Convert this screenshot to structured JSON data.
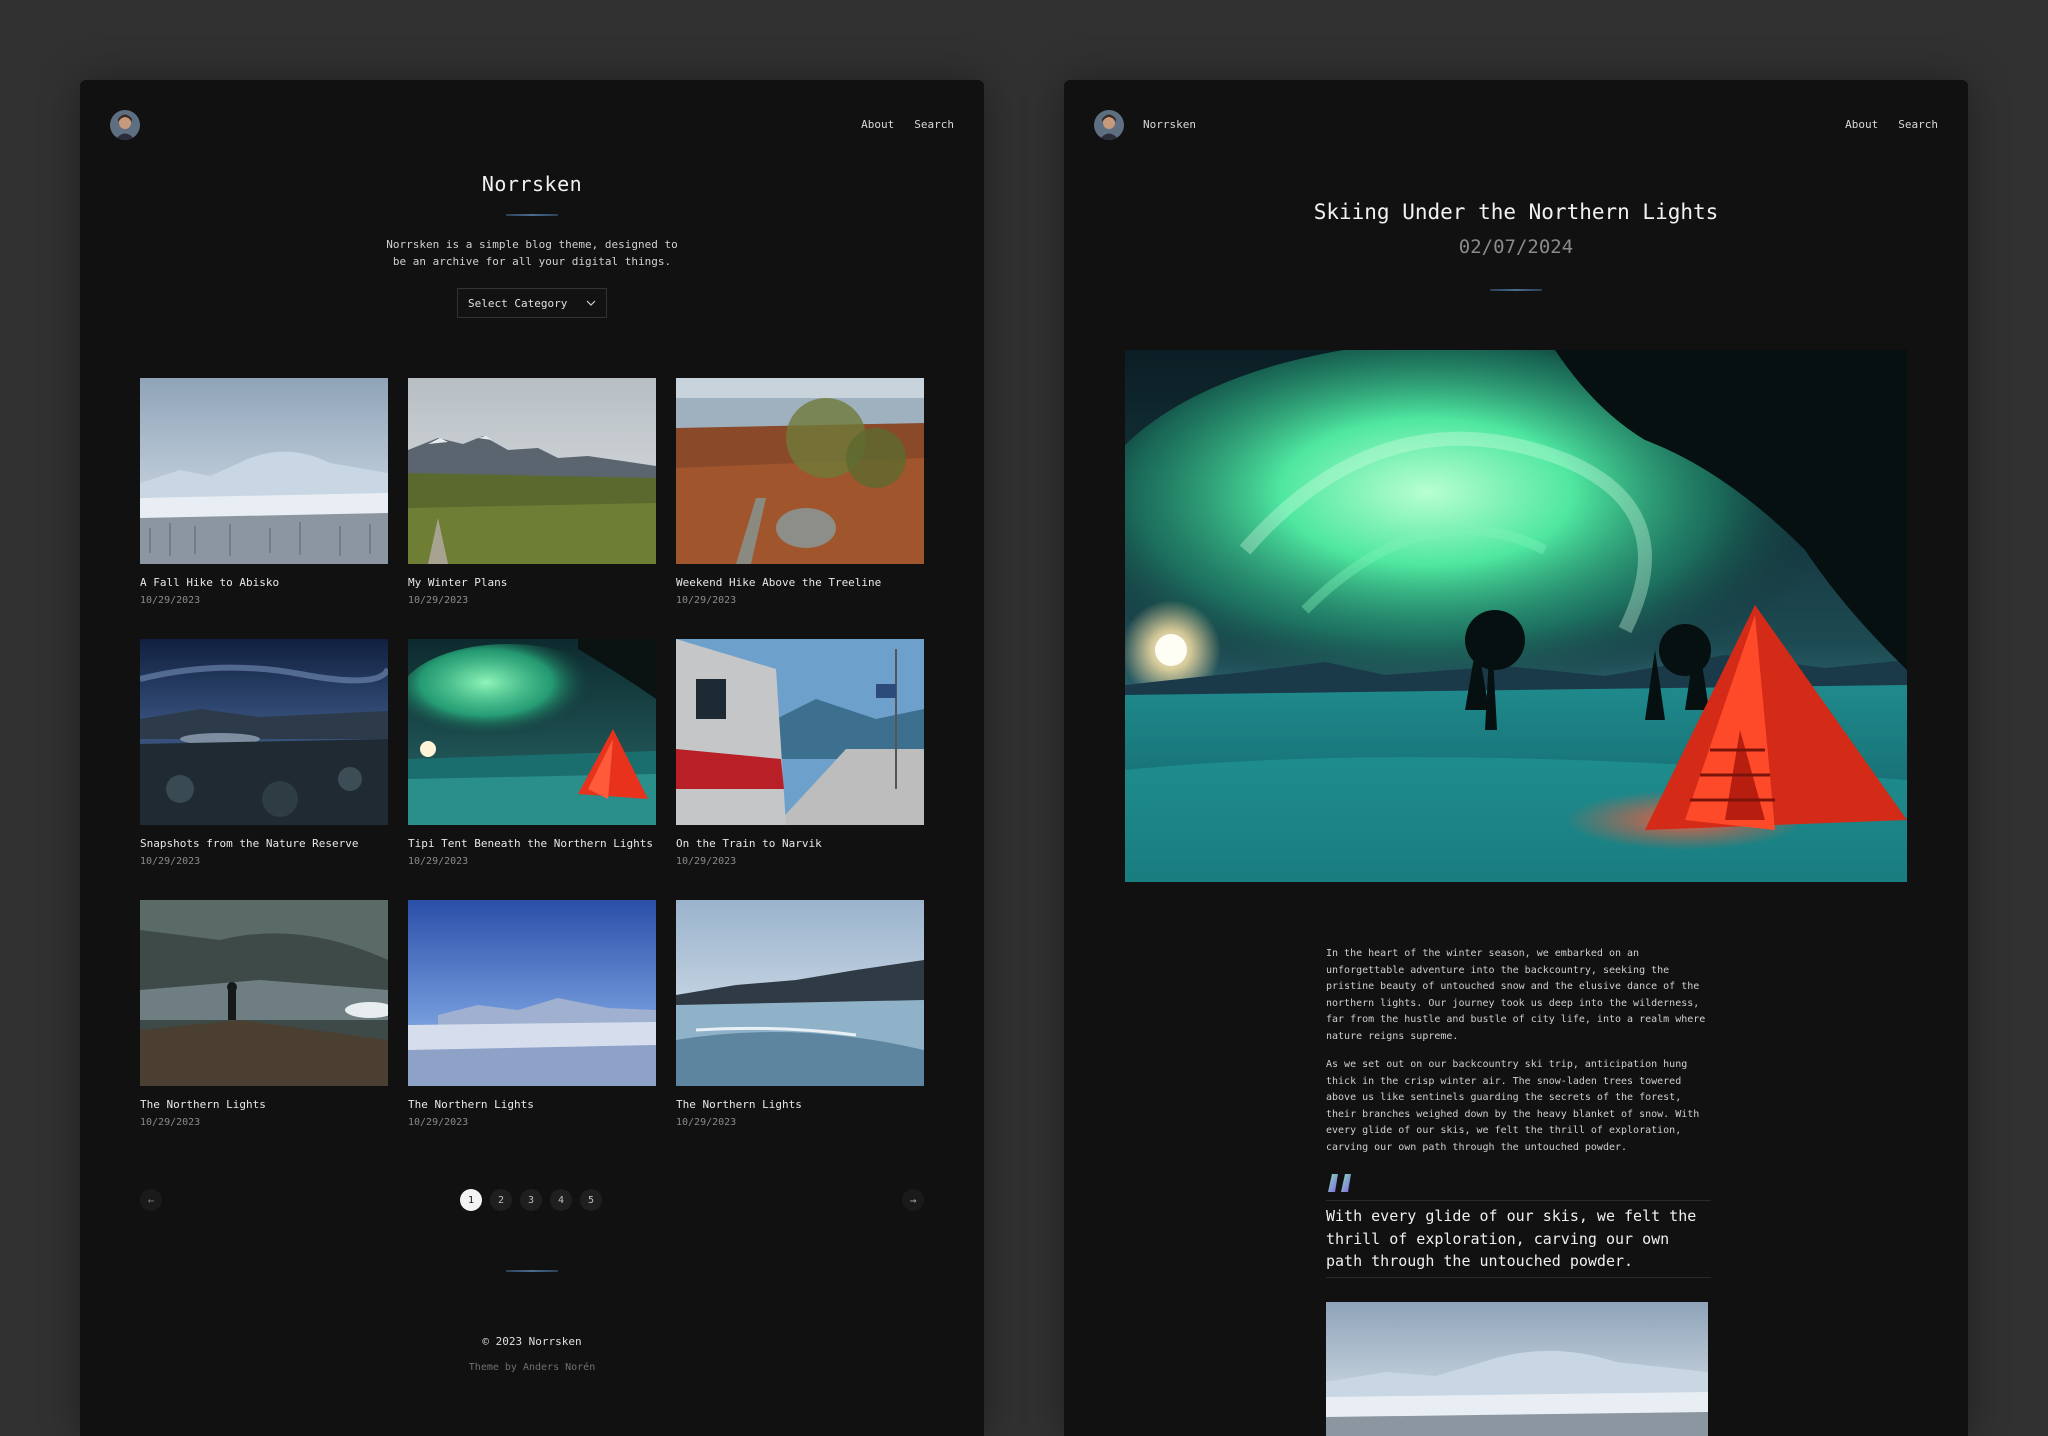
{
  "left": {
    "nav": {
      "about": "About",
      "search": "Search"
    },
    "blog_title": "Norrsken",
    "tagline_line1": "Norrsken is a simple blog theme, designed to",
    "tagline_line2": "be an archive for all your digital things.",
    "category_select": {
      "selected": "Select Category",
      "icon": "chevron-down-icon"
    },
    "posts": [
      {
        "title": "A Fall Hike to Abisko",
        "date": "10/29/2023"
      },
      {
        "title": "My Winter Plans",
        "date": "10/29/2023"
      },
      {
        "title": "Weekend Hike Above the Treeline",
        "date": "10/29/2023"
      },
      {
        "title": "Snapshots from the Nature Reserve",
        "date": "10/29/2023"
      },
      {
        "title": "Tipi Tent Beneath the Northern Lights",
        "date": "10/29/2023"
      },
      {
        "title": "On the Train to Narvik",
        "date": "10/29/2023"
      },
      {
        "title": "The Northern Lights",
        "date": "10/29/2023"
      },
      {
        "title": "The Northern Lights",
        "date": "10/29/2023"
      },
      {
        "title": "The Northern Lights",
        "date": "10/29/2023"
      }
    ],
    "pagination": {
      "pages": [
        "1",
        "2",
        "3",
        "4",
        "5"
      ],
      "current": "1",
      "prev": "←",
      "next": "→"
    },
    "footer": {
      "copyright": "© 2023 Norrsken",
      "credit": "Theme by Anders Norén"
    }
  },
  "right": {
    "site_name": "Norrsken",
    "nav": {
      "about": "About",
      "search": "Search"
    },
    "post": {
      "title": "Skiing Under the Northern Lights",
      "date": "02/07/2024",
      "paragraph1": "In the heart of the winter season, we embarked on an unforgettable adventure into the backcountry, seeking the pristine beauty of untouched snow and the elusive dance of the northern lights. Our journey took us deep into the wilderness, far from the hustle and bustle of city life, into a realm where nature reigns supreme.",
      "paragraph2": "As we set out on our backcountry ski trip, anticipation hung thick in the crisp winter air. The snow-laden trees towered above us like sentinels guarding the secrets of the forest, their branches weighed down by the heavy blanket of snow. With every glide of our skis, we felt the thrill of exploration, carving our own path through the untouched powder.",
      "quote": "With every glide of our skis, we felt the thrill of exploration, carving our own path through the untouched powder."
    }
  },
  "colors": {
    "page_bg": "#313131",
    "panel_bg": "#111111",
    "accent": "#4a6d8f",
    "tent_red": "#e8321c",
    "aurora_green": "#4fe7a0"
  }
}
